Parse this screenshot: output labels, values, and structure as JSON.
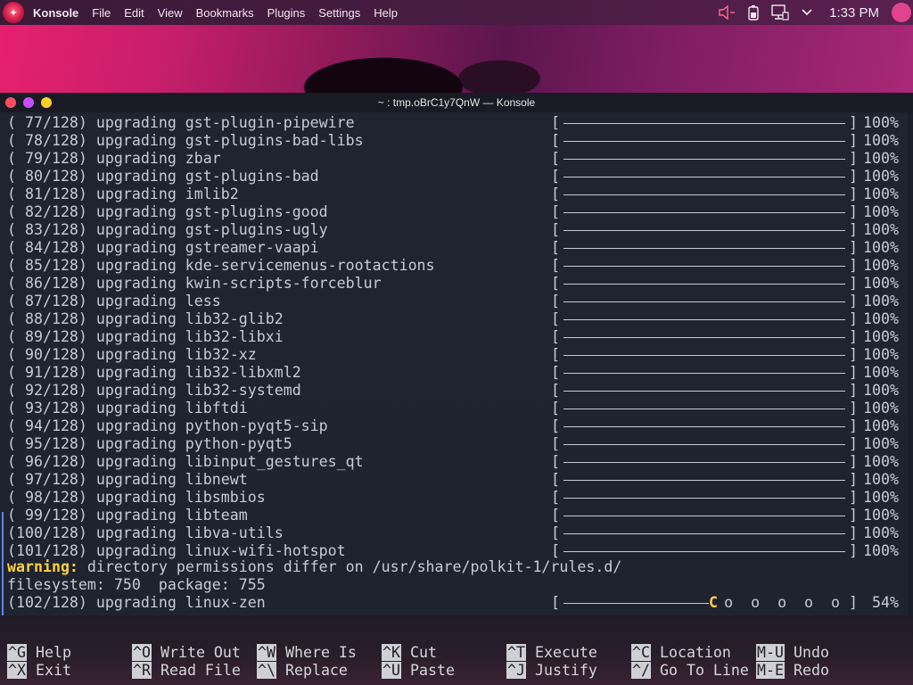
{
  "panel": {
    "app_name": "Konsole",
    "menu": [
      "File",
      "Edit",
      "View",
      "Bookmarks",
      "Plugins",
      "Settings",
      "Help"
    ],
    "clock": "1:33 PM",
    "icons": [
      "volume-icon",
      "battery-icon",
      "network-icon",
      "chevron-down-icon"
    ]
  },
  "window": {
    "title": "~ : tmp.oBrC1y7QnW — Konsole"
  },
  "terminal": {
    "lines": [
      {
        "text": "( 77/128) upgrading gst-plugin-pipewire",
        "progress": 1.0,
        "percent": "100%"
      },
      {
        "text": "( 78/128) upgrading gst-plugins-bad-libs",
        "progress": 1.0,
        "percent": "100%"
      },
      {
        "text": "( 79/128) upgrading zbar",
        "progress": 1.0,
        "percent": "100%"
      },
      {
        "text": "( 80/128) upgrading gst-plugins-bad",
        "progress": 1.0,
        "percent": "100%"
      },
      {
        "text": "( 81/128) upgrading imlib2",
        "progress": 1.0,
        "percent": "100%"
      },
      {
        "text": "( 82/128) upgrading gst-plugins-good",
        "progress": 1.0,
        "percent": "100%"
      },
      {
        "text": "( 83/128) upgrading gst-plugins-ugly",
        "progress": 1.0,
        "percent": "100%"
      },
      {
        "text": "( 84/128) upgrading gstreamer-vaapi",
        "progress": 1.0,
        "percent": "100%"
      },
      {
        "text": "( 85/128) upgrading kde-servicemenus-rootactions",
        "progress": 1.0,
        "percent": "100%"
      },
      {
        "text": "( 86/128) upgrading kwin-scripts-forceblur",
        "progress": 1.0,
        "percent": "100%"
      },
      {
        "text": "( 87/128) upgrading less",
        "progress": 1.0,
        "percent": "100%"
      },
      {
        "text": "( 88/128) upgrading lib32-glib2",
        "progress": 1.0,
        "percent": "100%"
      },
      {
        "text": "( 89/128) upgrading lib32-libxi",
        "progress": 1.0,
        "percent": "100%"
      },
      {
        "text": "( 90/128) upgrading lib32-xz",
        "progress": 1.0,
        "percent": "100%"
      },
      {
        "text": "( 91/128) upgrading lib32-libxml2",
        "progress": 1.0,
        "percent": "100%"
      },
      {
        "text": "( 92/128) upgrading lib32-systemd",
        "progress": 1.0,
        "percent": "100%"
      },
      {
        "text": "( 93/128) upgrading libftdi",
        "progress": 1.0,
        "percent": "100%"
      },
      {
        "text": "( 94/128) upgrading python-pyqt5-sip",
        "progress": 1.0,
        "percent": "100%"
      },
      {
        "text": "( 95/128) upgrading python-pyqt5",
        "progress": 1.0,
        "percent": "100%"
      },
      {
        "text": "( 96/128) upgrading libinput_gestures_qt",
        "progress": 1.0,
        "percent": "100%"
      },
      {
        "text": "( 97/128) upgrading libnewt",
        "progress": 1.0,
        "percent": "100%"
      },
      {
        "text": "( 98/128) upgrading libsmbios",
        "progress": 1.0,
        "percent": "100%"
      },
      {
        "text": "( 99/128) upgrading libteam",
        "progress": 1.0,
        "percent": "100%"
      },
      {
        "text": "(100/128) upgrading libva-utils",
        "progress": 1.0,
        "percent": "100%"
      },
      {
        "text": "(101/128) upgrading linux-wifi-hotspot",
        "progress": 1.0,
        "percent": "100%"
      }
    ],
    "warning_label": "warning:",
    "warning_text": " directory permissions differ on /usr/share/polkit-1/rules.d/",
    "filesystem_line": "filesystem: 750  package: 755",
    "current": {
      "text": "(102/128) upgrading linux-zen",
      "progress": 0.54,
      "pac_char": "C",
      "dots": " o  o  o  o  o ",
      "percent": "54%"
    }
  },
  "nano": {
    "shortcuts": [
      {
        "key": "^G",
        "label": "Help"
      },
      {
        "key": "^X",
        "label": "Exit"
      },
      {
        "key": "^O",
        "label": "Write Out"
      },
      {
        "key": "^R",
        "label": "Read File"
      },
      {
        "key": "^W",
        "label": "Where Is"
      },
      {
        "key": "^\\",
        "label": "Replace"
      },
      {
        "key": "^K",
        "label": "Cut"
      },
      {
        "key": "^U",
        "label": "Paste"
      },
      {
        "key": "^T",
        "label": "Execute"
      },
      {
        "key": "^J",
        "label": "Justify"
      },
      {
        "key": "^C",
        "label": "Location"
      },
      {
        "key": "^/",
        "label": "Go To Line"
      },
      {
        "key": "M-U",
        "label": "Undo"
      },
      {
        "key": "M-E",
        "label": "Redo"
      }
    ]
  },
  "colors": {
    "warning": "#ffd23a",
    "accent": "#e0448c",
    "terminal_bg": "#1f2330"
  }
}
